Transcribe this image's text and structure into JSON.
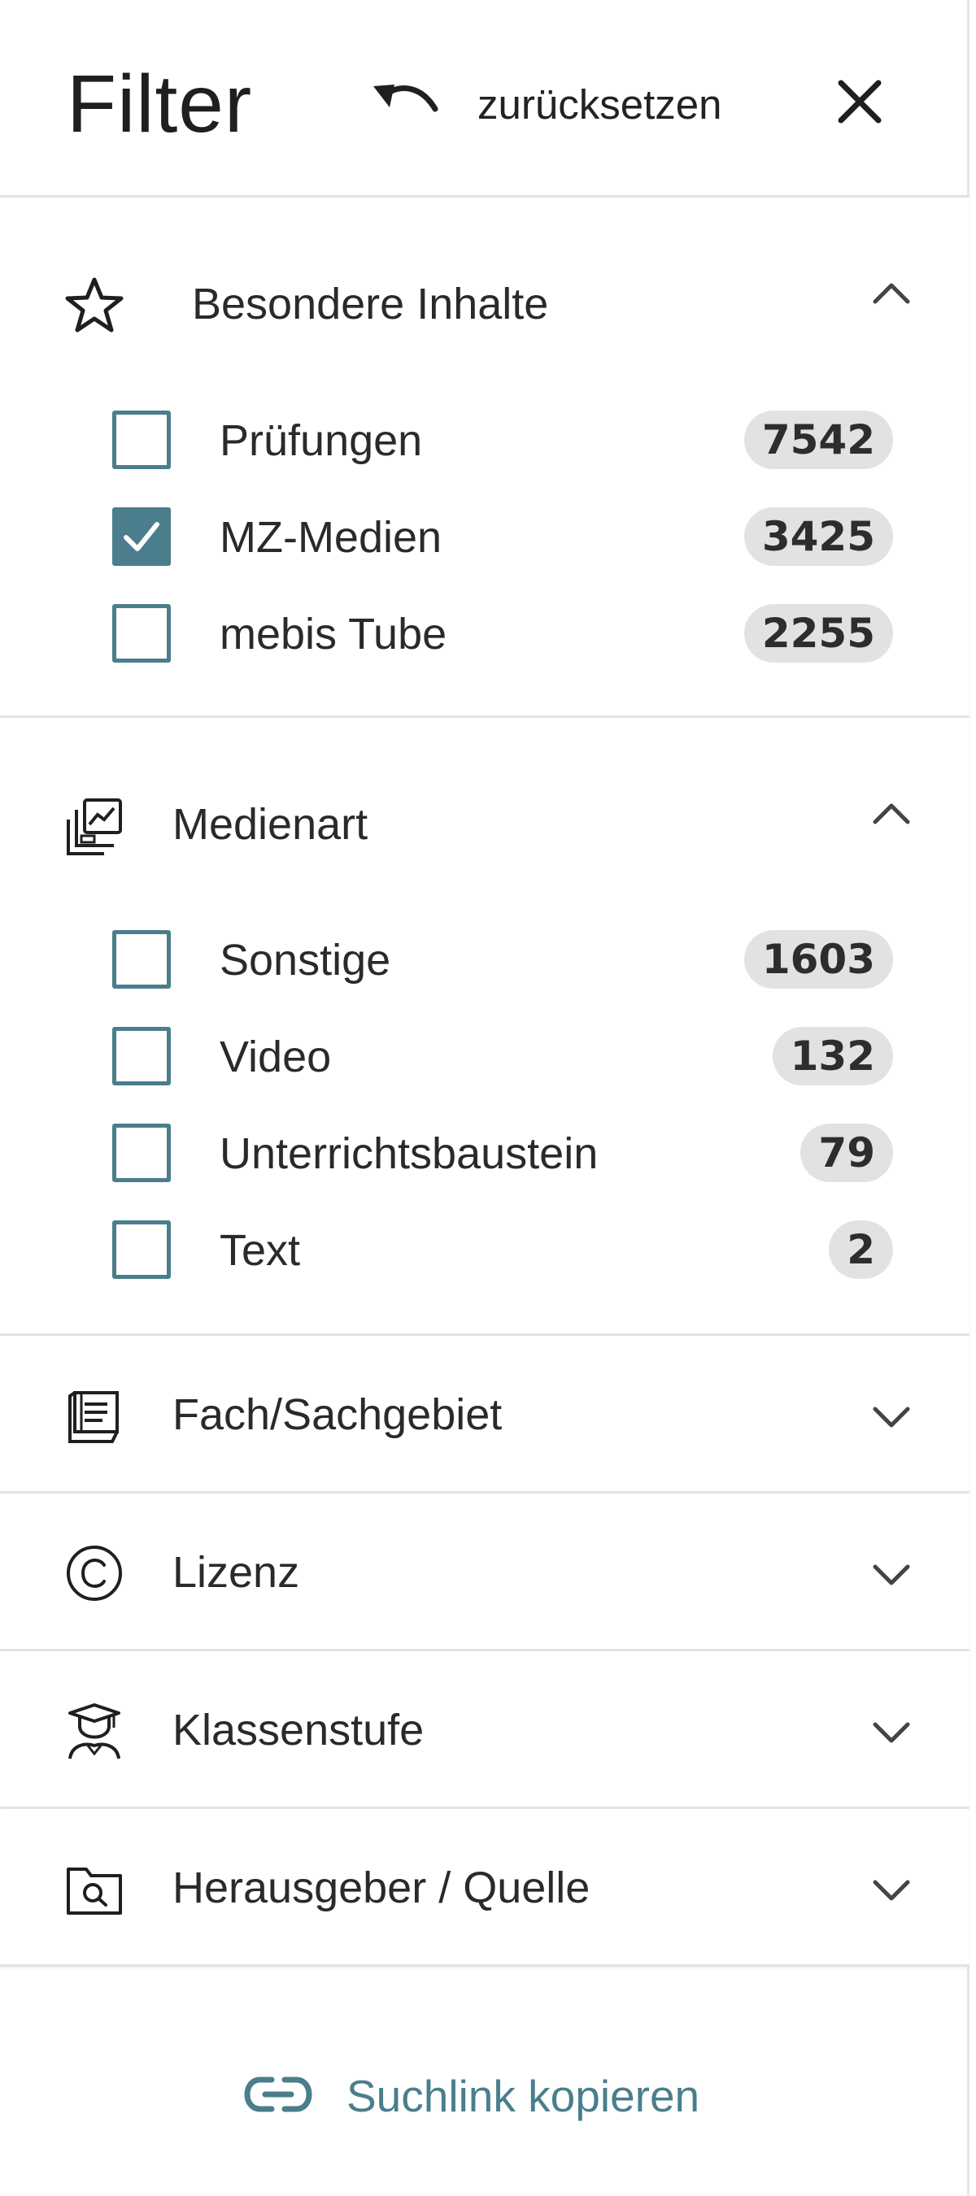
{
  "header": {
    "title": "Filter",
    "reset_label": "zurücksetzen"
  },
  "sections": [
    {
      "title": "Besondere Inhalte",
      "icon": "star-icon",
      "expanded": true,
      "items": [
        {
          "label": "Prüfungen",
          "count": "7542",
          "checked": false
        },
        {
          "label": "MZ-Medien",
          "count": "3425",
          "checked": true
        },
        {
          "label": "mebis Tube",
          "count": "2255",
          "checked": false
        }
      ]
    },
    {
      "title": "Medienart",
      "icon": "media-type-icon",
      "expanded": true,
      "items": [
        {
          "label": "Sonstige",
          "count": "1603",
          "checked": false
        },
        {
          "label": "Video",
          "count": "132",
          "checked": false
        },
        {
          "label": "Unterrichtsbaustein",
          "count": "79",
          "checked": false
        },
        {
          "label": "Text",
          "count": "2",
          "checked": false
        }
      ]
    },
    {
      "title": "Fach/Sachgebiet",
      "icon": "book-icon",
      "expanded": false
    },
    {
      "title": "Lizenz",
      "icon": "copyright-icon",
      "expanded": false
    },
    {
      "title": "Klassenstufe",
      "icon": "graduate-icon",
      "expanded": false
    },
    {
      "title": "Herausgeber / Quelle",
      "icon": "folder-search-icon",
      "expanded": false
    }
  ],
  "footer": {
    "copy_link_label": "Suchlink kopieren"
  },
  "colors": {
    "accent": "#4a7e8c",
    "badge_bg": "#e2e2e2",
    "divider": "#e3e3e3"
  }
}
